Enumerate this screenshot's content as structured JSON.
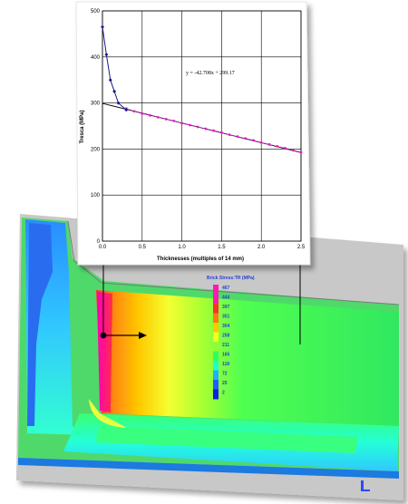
{
  "chart_data": [
    {
      "type": "line",
      "xlabel": "Thicknesses (multiples of 14 mm)",
      "ylabel": "Tresca (MPa)",
      "xlim": [
        0,
        2.5
      ],
      "ylim": [
        0,
        500
      ],
      "x_ticks": [
        "0.0",
        "0.5",
        "1.0",
        "1.5",
        "2.0",
        "2.5"
      ],
      "y_ticks": [
        "0",
        "100",
        "200",
        "300",
        "400",
        "500"
      ],
      "grid": true,
      "annotation": "y = -42.708x + 299.17",
      "series": [
        {
          "style": "blue line with diamond markers",
          "color": "#1a1a8c",
          "x": [
            0.0,
            0.05,
            0.1,
            0.15,
            0.2,
            0.3
          ],
          "y": [
            465,
            405,
            350,
            325,
            300,
            285
          ]
        },
        {
          "style": "magenta dotted markers",
          "color": "#e020c8",
          "x": [
            0.3,
            0.4,
            0.5,
            0.6,
            0.7,
            0.8,
            0.9,
            1.0,
            1.1,
            1.2,
            1.3,
            1.4,
            1.5,
            1.6,
            1.7,
            1.8,
            1.9,
            2.0,
            2.1,
            2.2,
            2.3,
            2.4,
            2.5
          ],
          "y": [
            288,
            282,
            277,
            273,
            269,
            265,
            261,
            256,
            252,
            248,
            244,
            240,
            236,
            231,
            227,
            223,
            219,
            214,
            210,
            206,
            202,
            197,
            193
          ]
        },
        {
          "style": "black linear trendline",
          "color": "#000000",
          "x": [
            0,
            2.5
          ],
          "y": [
            299.17,
            192.4
          ]
        }
      ]
    },
    {
      "type": "heatmap",
      "legend_title": "Brick Stress:TR (MPa)",
      "legend_values": [
        "467",
        "444",
        "397",
        "351",
        "304",
        "258",
        "211",
        "165",
        "118",
        "72",
        "25",
        "2"
      ],
      "legend_colors": [
        "#ff1ab0",
        "#ff1ab0",
        "#ff3030",
        "#ff7a10",
        "#ffc800",
        "#f0ff20",
        "#8cff30",
        "#30ff60",
        "#20ffc8",
        "#20b0ff",
        "#2060ff",
        "#1020e0"
      ]
    }
  ]
}
